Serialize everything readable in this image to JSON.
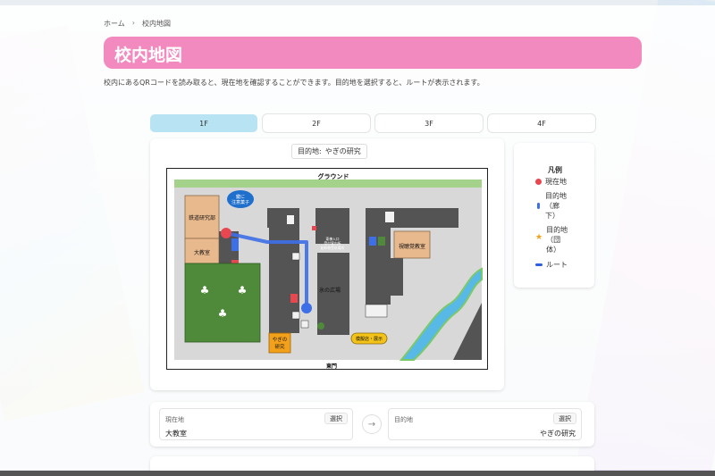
{
  "breadcrumb": {
    "home": "ホーム",
    "separator": "›",
    "current": "校内地図"
  },
  "page": {
    "title": "校内地図",
    "description": "校内にあるQRコードを読み取ると、現在地を確認することができます。目的地を選択すると、ルートが表示されます。"
  },
  "floors": [
    {
      "label": "1F",
      "active": true
    },
    {
      "label": "2F",
      "active": false
    },
    {
      "label": "3F",
      "active": false
    },
    {
      "label": "4F",
      "active": false
    }
  ],
  "destination_pill": {
    "prefix": "目的地:",
    "name": "やぎの研究"
  },
  "map": {
    "labels": {
      "ground": "グラウンド",
      "railway_club": "鉄道研究部",
      "big_classroom": "大教室",
      "av_room": "視聴覚教室",
      "plaza": "氷の広場",
      "east_gate": "東門",
      "yagi_lab_line1": "やぎの",
      "yagi_lab_line2": "研究",
      "info_sign": "模擬店・展示",
      "speech_line1": "鍵に",
      "speech_line2": "注意菓子",
      "entrance_line1": "東棟入口",
      "entrance_line2": "受付案内所",
      "entrance_line3": "配布物受取場所"
    }
  },
  "legend": {
    "title": "凡例",
    "items": [
      {
        "symbol": "red-dot-icon",
        "text": [
          "現在地"
        ]
      },
      {
        "symbol": "blue-marker-icon",
        "text": [
          "目的地",
          "（廊",
          "下）"
        ]
      },
      {
        "symbol": "star-icon",
        "text": [
          "目的地",
          "（団",
          "体）"
        ]
      },
      {
        "symbol": "route-line-icon",
        "text": [
          "ルート"
        ]
      }
    ]
  },
  "selector": {
    "current": {
      "label": "現在地",
      "value": "大教室",
      "button": "選択"
    },
    "destination": {
      "label": "目的地",
      "value": "やぎの研究",
      "button": "選択"
    },
    "swap": "→"
  },
  "colors": {
    "accent_pink": "#f28abf",
    "active_tab": "#b8e3f2",
    "route_blue": "#3d6fe8",
    "current_red": "#e8474f",
    "building_gray": "#545454",
    "lawn_green": "#4f8a3b",
    "ground_green": "#a5d28a"
  }
}
